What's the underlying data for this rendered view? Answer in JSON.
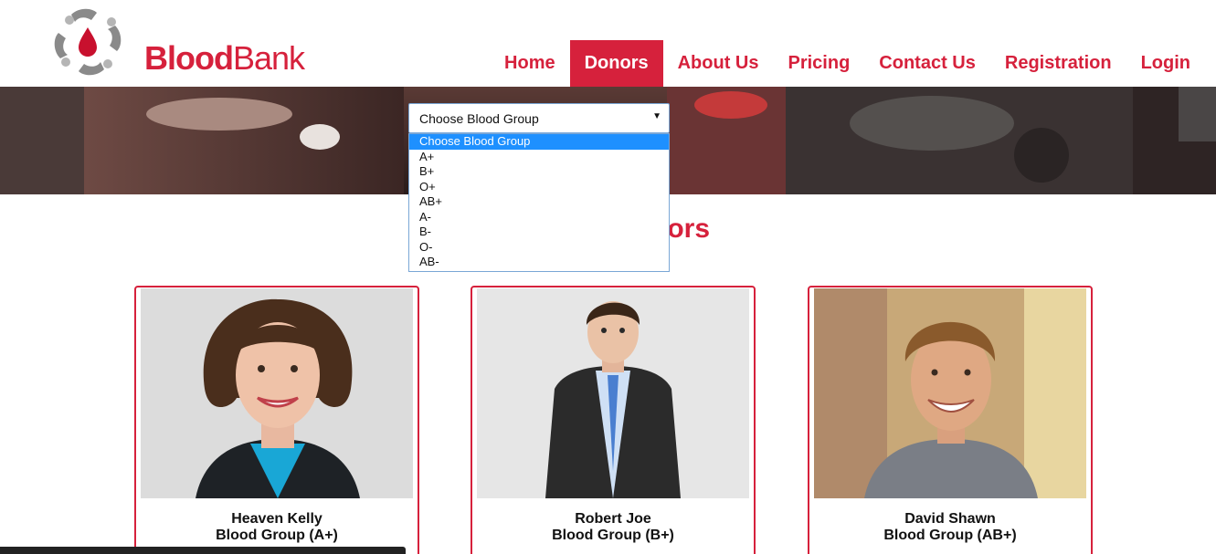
{
  "brand": {
    "name_part1": "Blood",
    "name_part2": "Bank",
    "color": "#d6213c"
  },
  "nav": {
    "items": [
      {
        "label": "Home",
        "active": false
      },
      {
        "label": "Donors",
        "active": true
      },
      {
        "label": "About Us",
        "active": false
      },
      {
        "label": "Pricing",
        "active": false
      },
      {
        "label": "Contact Us",
        "active": false
      },
      {
        "label": "Registration",
        "active": false
      },
      {
        "label": "Login",
        "active": false
      }
    ]
  },
  "filter": {
    "selected": "Choose Blood Group",
    "options": [
      "Choose Blood Group",
      "A+",
      "B+",
      "O+",
      "AB+",
      "A-",
      "B-",
      "O-",
      "AB-"
    ]
  },
  "section": {
    "title_visible": "nors"
  },
  "donors": [
    {
      "name": "Heaven Kelly",
      "group": "Blood Group (A+)"
    },
    {
      "name": "Robert Joe",
      "group": "Blood Group (B+)"
    },
    {
      "name": "David Shawn",
      "group": "Blood Group (AB+)"
    }
  ]
}
